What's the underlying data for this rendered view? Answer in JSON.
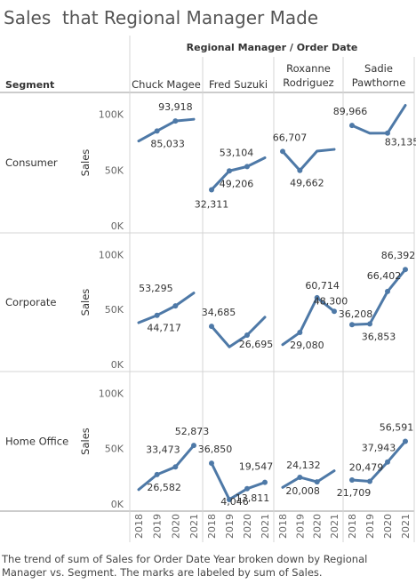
{
  "title": "Sales  that Regional Manager Made",
  "caption": "The trend of sum of Sales for Order Date Year broken down by Regional Manager vs. Segment.  The marks are labeled by sum of Sales.",
  "colors": {
    "line": "#4e79a7",
    "grid": "#d4d4d4",
    "text": "#333333",
    "axis_text": "#666666"
  },
  "chart_data": {
    "type": "line",
    "column_header": "Regional Manager / Order Date",
    "row_header": "Segment",
    "managers": [
      {
        "name": "Chuck Magee",
        "label_lines": [
          "Chuck Magee"
        ]
      },
      {
        "name": "Fred Suzuki",
        "label_lines": [
          "Fred Suzuki"
        ]
      },
      {
        "name": "Roxanne Rodriguez",
        "label_lines": [
          "Roxanne",
          "Rodriguez"
        ]
      },
      {
        "name": "Sadie Pawthorne",
        "label_lines": [
          "Sadie",
          "Pawthorne"
        ]
      }
    ],
    "segments": [
      "Consumer",
      "Corporate",
      "Home Office"
    ],
    "x": [
      "2018",
      "2019",
      "2020",
      "2021"
    ],
    "ylabel": "Sales",
    "ylim": [
      0,
      110000
    ],
    "yticks": [
      0,
      50000,
      100000
    ],
    "ytick_labels": [
      "0K",
      "50K",
      "100K"
    ],
    "series": [
      {
        "segment": "Consumer",
        "manager": "Chuck Magee",
        "values": [
          76000,
          85033,
          93918,
          95500
        ],
        "labels": [
          null,
          "85,033",
          "93,918",
          null
        ]
      },
      {
        "segment": "Consumer",
        "manager": "Fred Suzuki",
        "values": [
          32311,
          49206,
          53104,
          61000
        ],
        "labels": [
          "32,311",
          "49,206",
          "53,104",
          null
        ]
      },
      {
        "segment": "Consumer",
        "manager": "Roxanne Rodriguez",
        "values": [
          66707,
          49662,
          67000,
          68500
        ],
        "labels": [
          "66,707",
          "49,662",
          null,
          null
        ]
      },
      {
        "segment": "Consumer",
        "manager": "Sadie Pawthorne",
        "values": [
          89966,
          83000,
          83135,
          108000
        ],
        "labels": [
          "89,966",
          null,
          "83,135",
          null
        ]
      },
      {
        "segment": "Corporate",
        "manager": "Chuck Magee",
        "values": [
          38000,
          44717,
          53295,
          65000
        ],
        "labels": [
          null,
          "44,717",
          "53,295",
          null
        ]
      },
      {
        "segment": "Corporate",
        "manager": "Fred Suzuki",
        "values": [
          34685,
          16000,
          26695,
          43000
        ],
        "labels": [
          "34,685",
          null,
          "26,695",
          null
        ]
      },
      {
        "segment": "Corporate",
        "manager": "Roxanne Rodriguez",
        "values": [
          18000,
          29080,
          60714,
          48300
        ],
        "labels": [
          null,
          "29,080",
          "60,714",
          "48,300"
        ]
      },
      {
        "segment": "Corporate",
        "manager": "Sadie Pawthorne",
        "values": [
          36208,
          36853,
          66402,
          86392
        ],
        "labels": [
          "36,208",
          "36,853",
          "66,402",
          "86,392"
        ]
      },
      {
        "segment": "Home Office",
        "manager": "Chuck Magee",
        "values": [
          13000,
          26582,
          33473,
          52873
        ],
        "labels": [
          null,
          "26,582",
          "33,473",
          "52,873"
        ]
      },
      {
        "segment": "Home Office",
        "manager": "Fred Suzuki",
        "values": [
          36850,
          4046,
          13811,
          19547
        ],
        "labels": [
          "36,850",
          "4,046",
          "13,811",
          "19,547"
        ]
      },
      {
        "segment": "Home Office",
        "manager": "Roxanne Rodriguez",
        "values": [
          15000,
          24132,
          20008,
          30000
        ],
        "labels": [
          null,
          "24,132",
          "20,008",
          null
        ]
      },
      {
        "segment": "Home Office",
        "manager": "Sadie Pawthorne",
        "values": [
          21709,
          20479,
          37943,
          56591
        ],
        "labels": [
          "21,709",
          "20,479",
          "37,943",
          "56,591"
        ]
      }
    ]
  }
}
